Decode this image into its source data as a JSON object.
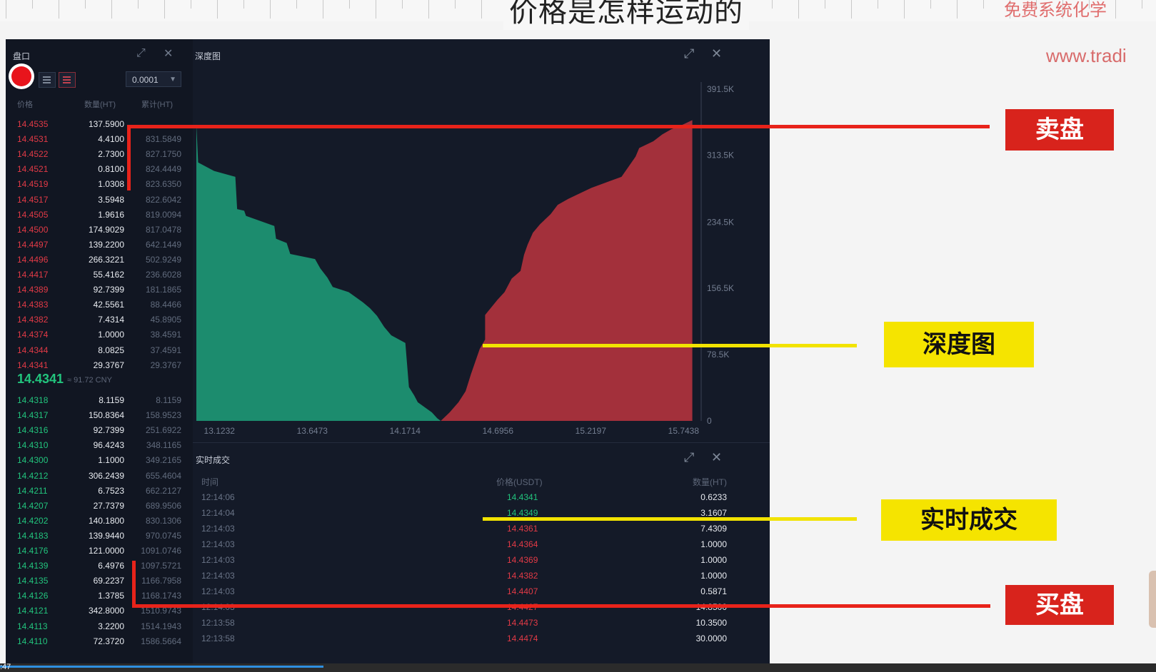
{
  "slide": {
    "title": "价格是怎样运动的",
    "brand": "免费系统化学",
    "url": "www.tradi"
  },
  "orderbook": {
    "title": "盘口",
    "precision": "0.0001",
    "headers": {
      "price": "价格",
      "amount": "数量(HT)",
      "total": "累计(HT)"
    },
    "asks": [
      {
        "price": "14.4535",
        "amount": "137.5900",
        "total": ""
      },
      {
        "price": "14.4531",
        "amount": "4.4100",
        "total": "831.5849"
      },
      {
        "price": "14.4522",
        "amount": "2.7300",
        "total": "827.1750"
      },
      {
        "price": "14.4521",
        "amount": "0.8100",
        "total": "824.4449"
      },
      {
        "price": "14.4519",
        "amount": "1.0308",
        "total": "823.6350"
      },
      {
        "price": "14.4517",
        "amount": "3.5948",
        "total": "822.6042"
      },
      {
        "price": "14.4505",
        "amount": "1.9616",
        "total": "819.0094"
      },
      {
        "price": "14.4500",
        "amount": "174.9029",
        "total": "817.0478"
      },
      {
        "price": "14.4497",
        "amount": "139.2200",
        "total": "642.1449"
      },
      {
        "price": "14.4496",
        "amount": "266.3221",
        "total": "502.9249"
      },
      {
        "price": "14.4417",
        "amount": "55.4162",
        "total": "236.6028"
      },
      {
        "price": "14.4389",
        "amount": "92.7399",
        "total": "181.1865"
      },
      {
        "price": "14.4383",
        "amount": "42.5561",
        "total": "88.4466"
      },
      {
        "price": "14.4382",
        "amount": "7.4314",
        "total": "45.8905"
      },
      {
        "price": "14.4374",
        "amount": "1.0000",
        "total": "38.4591"
      },
      {
        "price": "14.4344",
        "amount": "8.0825",
        "total": "37.4591"
      },
      {
        "price": "14.4341",
        "amount": "29.3767",
        "total": "29.3767"
      }
    ],
    "last_price": "14.4341",
    "last_cny": "≈ 91.72 CNY",
    "bids": [
      {
        "price": "14.4318",
        "amount": "8.1159",
        "total": "8.1159"
      },
      {
        "price": "14.4317",
        "amount": "150.8364",
        "total": "158.9523"
      },
      {
        "price": "14.4316",
        "amount": "92.7399",
        "total": "251.6922"
      },
      {
        "price": "14.4310",
        "amount": "96.4243",
        "total": "348.1165"
      },
      {
        "price": "14.4300",
        "amount": "1.1000",
        "total": "349.2165"
      },
      {
        "price": "14.4212",
        "amount": "306.2439",
        "total": "655.4604"
      },
      {
        "price": "14.4211",
        "amount": "6.7523",
        "total": "662.2127"
      },
      {
        "price": "14.4207",
        "amount": "27.7379",
        "total": "689.9506"
      },
      {
        "price": "14.4202",
        "amount": "140.1800",
        "total": "830.1306"
      },
      {
        "price": "14.4183",
        "amount": "139.9440",
        "total": "970.0745"
      },
      {
        "price": "14.4176",
        "amount": "121.0000",
        "total": "1091.0746"
      },
      {
        "price": "14.4139",
        "amount": "6.4976",
        "total": "1097.5721"
      },
      {
        "price": "14.4135",
        "amount": "69.2237",
        "total": "1166.7958"
      },
      {
        "price": "14.4126",
        "amount": "1.3785",
        "total": "1168.1743"
      },
      {
        "price": "14.4121",
        "amount": "342.8000",
        "total": "1510.9743"
      },
      {
        "price": "14.4113",
        "amount": "3.2200",
        "total": "1514.1943"
      },
      {
        "price": "14.4110",
        "amount": "72.3720",
        "total": "1586.5664"
      }
    ]
  },
  "depth": {
    "title": "深度图",
    "bid_color": "#1c8c6e",
    "ask_color": "#a3303b"
  },
  "chart_data": {
    "type": "area",
    "title": "深度图",
    "x_ticks": [
      "13.1232",
      "13.6473",
      "14.1714",
      "14.6956",
      "15.2197",
      "15.7438"
    ],
    "y_ticks": [
      "0",
      "78.5K",
      "156.5K",
      "234.5K",
      "313.5K",
      "391.5K"
    ],
    "xlim": [
      13.0,
      15.85
    ],
    "ylim": [
      0,
      391500
    ],
    "series": [
      {
        "side": "bid",
        "x": [
          13.0,
          13.01,
          13.1,
          13.22,
          13.23,
          13.27,
          13.28,
          13.44,
          13.45,
          13.51,
          13.53,
          13.67,
          13.7,
          13.74,
          13.77,
          13.86,
          13.9,
          13.94,
          13.98,
          14.02,
          14.06,
          14.1,
          14.18,
          14.2,
          14.23,
          14.25,
          14.29,
          14.33,
          14.36,
          14.38
        ],
        "y": [
          350000,
          305000,
          295000,
          288000,
          250000,
          248000,
          242000,
          230000,
          215000,
          210000,
          197000,
          191000,
          180000,
          169000,
          158000,
          152000,
          146000,
          140000,
          133000,
          124000,
          111000,
          101000,
          92000,
          40000,
          30000,
          22000,
          16000,
          10000,
          3000,
          0
        ]
      },
      {
        "side": "ask",
        "x": [
          14.38,
          14.43,
          14.48,
          14.52,
          14.55,
          14.6,
          14.63,
          14.63,
          14.7,
          14.74,
          14.78,
          14.83,
          14.85,
          14.87,
          14.9,
          14.94,
          15.0,
          15.04,
          15.1,
          15.18,
          15.23,
          15.32,
          15.4,
          15.48,
          15.5,
          15.58,
          15.63,
          15.68,
          15.75,
          15.8,
          15.8
        ],
        "y": [
          0,
          10000,
          22000,
          35000,
          55000,
          85000,
          96000,
          125000,
          143000,
          152000,
          168000,
          177000,
          196000,
          208000,
          222000,
          232000,
          244000,
          255000,
          262000,
          270000,
          275000,
          282000,
          288000,
          312000,
          322000,
          330000,
          338000,
          344000,
          350000,
          355000,
          391500
        ]
      }
    ]
  },
  "trades": {
    "title": "实时成交",
    "headers": {
      "time": "时间",
      "price": "价格(USDT)",
      "amount": "数量(HT)"
    },
    "rows": [
      {
        "time": "12:14:06",
        "price": "14.4341",
        "amount": "0.6233",
        "side": "buy"
      },
      {
        "time": "12:14:04",
        "price": "14.4349",
        "amount": "3.1607",
        "side": "buy"
      },
      {
        "time": "12:14:03",
        "price": "14.4361",
        "amount": "7.4309",
        "side": "sell"
      },
      {
        "time": "12:14:03",
        "price": "14.4364",
        "amount": "1.0000",
        "side": "sell"
      },
      {
        "time": "12:14:03",
        "price": "14.4369",
        "amount": "1.0000",
        "side": "sell"
      },
      {
        "time": "12:14:03",
        "price": "14.4382",
        "amount": "1.0000",
        "side": "sell"
      },
      {
        "time": "12:14:03",
        "price": "14.4407",
        "amount": "0.5871",
        "side": "sell"
      },
      {
        "time": "12:14:03",
        "price": "14.4427",
        "amount": "14.8500",
        "side": "sell"
      },
      {
        "time": "12:13:58",
        "price": "14.4473",
        "amount": "10.3500",
        "side": "sell"
      },
      {
        "time": "12:13:58",
        "price": "14.4474",
        "amount": "30.0000",
        "side": "sell"
      }
    ]
  },
  "annotations": {
    "sell": "卖盘",
    "depth": "深度图",
    "trades": "实时成交",
    "buy": "买盘"
  },
  "video": {
    "timestamp": ":47",
    "progress": 0.28
  }
}
